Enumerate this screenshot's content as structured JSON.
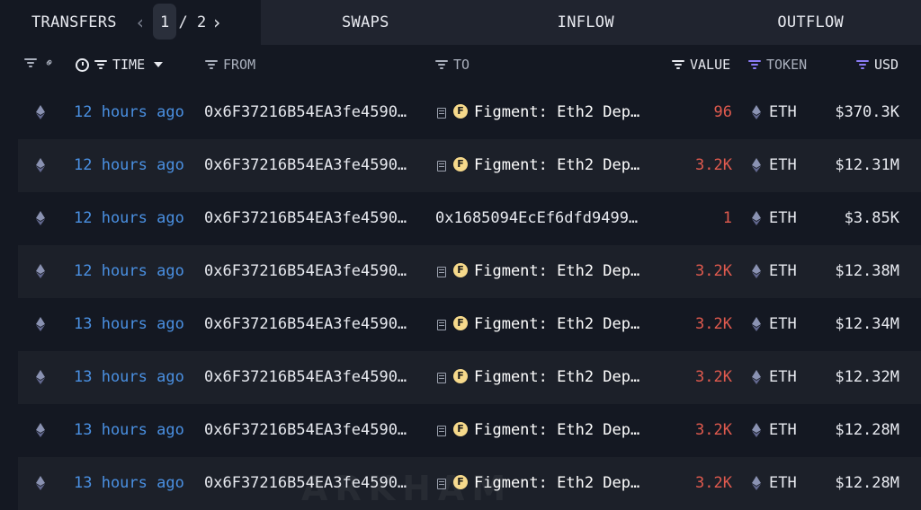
{
  "tabs": {
    "transfers": "TRANSFERS",
    "pager_prev": "‹",
    "pager_text": "1 / 2",
    "pager_next": "›",
    "swaps": "SWAPS",
    "inflow": "INFLOW",
    "outflow": "OUTFLOW"
  },
  "columns": {
    "time": "TIME",
    "from": "FROM",
    "to": "TO",
    "value": "VALUE",
    "token": "TOKEN",
    "usd": "USD"
  },
  "colors": {
    "background": "#141822",
    "row_alt": "#1c2029",
    "time_link": "#4a90e2",
    "value_red": "#e05a4e",
    "accent_purple": "#8b7cf6",
    "entity_badge": "#f6d98b"
  },
  "icons": {
    "chain": "ethereum-icon",
    "filter": "filter-icon",
    "link": "link-icon",
    "clock": "clock-icon",
    "sort": "sort-down-icon",
    "doc": "document-icon",
    "entity_badge_letter": "F"
  },
  "rows": [
    {
      "time": "12 hours ago",
      "from": "0x6F37216B54EA3fe4590…",
      "to": "Figment: Eth2 Dep…",
      "to_entity": true,
      "value": "96",
      "token": "ETH",
      "usd": "$370.3K"
    },
    {
      "time": "12 hours ago",
      "from": "0x6F37216B54EA3fe4590…",
      "to": "Figment: Eth2 Dep…",
      "to_entity": true,
      "value": "3.2K",
      "token": "ETH",
      "usd": "$12.31M"
    },
    {
      "time": "12 hours ago",
      "from": "0x6F37216B54EA3fe4590…",
      "to": "0x1685094EcEf6dfd9499…",
      "to_entity": false,
      "value": "1",
      "token": "ETH",
      "usd": "$3.85K"
    },
    {
      "time": "12 hours ago",
      "from": "0x6F37216B54EA3fe4590…",
      "to": "Figment: Eth2 Dep…",
      "to_entity": true,
      "value": "3.2K",
      "token": "ETH",
      "usd": "$12.38M"
    },
    {
      "time": "13 hours ago",
      "from": "0x6F37216B54EA3fe4590…",
      "to": "Figment: Eth2 Dep…",
      "to_entity": true,
      "value": "3.2K",
      "token": "ETH",
      "usd": "$12.34M"
    },
    {
      "time": "13 hours ago",
      "from": "0x6F37216B54EA3fe4590…",
      "to": "Figment: Eth2 Dep…",
      "to_entity": true,
      "value": "3.2K",
      "token": "ETH",
      "usd": "$12.32M"
    },
    {
      "time": "13 hours ago",
      "from": "0x6F37216B54EA3fe4590…",
      "to": "Figment: Eth2 Dep…",
      "to_entity": true,
      "value": "3.2K",
      "token": "ETH",
      "usd": "$12.28M"
    },
    {
      "time": "13 hours ago",
      "from": "0x6F37216B54EA3fe4590…",
      "to": "Figment: Eth2 Dep…",
      "to_entity": true,
      "value": "3.2K",
      "token": "ETH",
      "usd": "$12.28M"
    }
  ],
  "watermark": "ARKHAM"
}
